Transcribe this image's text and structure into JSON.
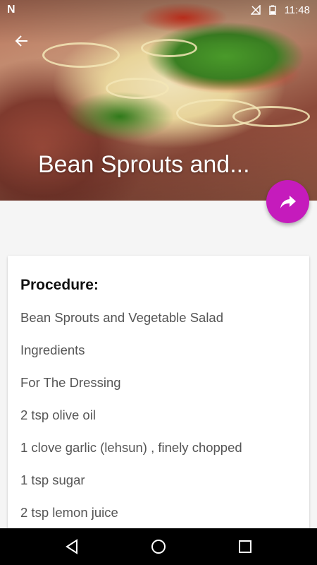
{
  "status_bar": {
    "app_icon": "N",
    "time": "11:48",
    "icons": [
      "signal-off-icon",
      "battery-icon"
    ]
  },
  "header": {
    "title": "Bean Sprouts and...",
    "back_icon": "arrow-left-icon",
    "share_icon": "share-arrow-icon",
    "fab_color": "#c51bbc"
  },
  "card": {
    "heading": "Procedure:",
    "lines": [
      "Bean Sprouts and Vegetable Salad",
      "Ingredients",
      "For The Dressing",
      "2 tsp olive oil",
      "1 clove garlic (lehsun) , finely chopped",
      "1 tsp sugar",
      "2 tsp lemon juice"
    ]
  },
  "nav_bar": {
    "buttons": [
      "back-triangle-icon",
      "home-circle-icon",
      "recents-square-icon"
    ]
  }
}
